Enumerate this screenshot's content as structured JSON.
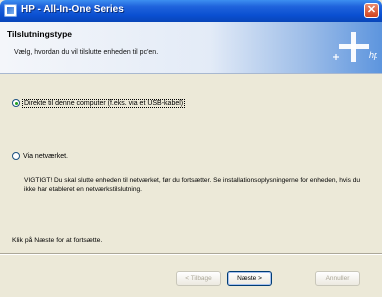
{
  "window": {
    "title": "HP - All-In-One Series",
    "close_glyph": "✕"
  },
  "header": {
    "title": "Tilslutningstype",
    "subtitle": "Vælg, hvordan du vil tilslutte enheden til pc'en."
  },
  "options": [
    {
      "label": "Direkte til denne computer (f.eks. via et USB-kabel)",
      "selected": true
    },
    {
      "label": "Via netværket.",
      "selected": false
    }
  ],
  "warning": "VIGTIGT! Du skal slutte enheden til netværket, før du fortsætter. Se installationsoplysningerne for enheden, hvis du ikke har etableret en netværkstilslutning.",
  "hint": "Klik på Næste for at fortsætte.",
  "buttons": {
    "back": "< Tilbage",
    "next": "Næste >",
    "cancel": "Annuller"
  },
  "colors": {
    "titlebar": "#0a4fd1",
    "dialog_bg": "#ece9d8"
  }
}
